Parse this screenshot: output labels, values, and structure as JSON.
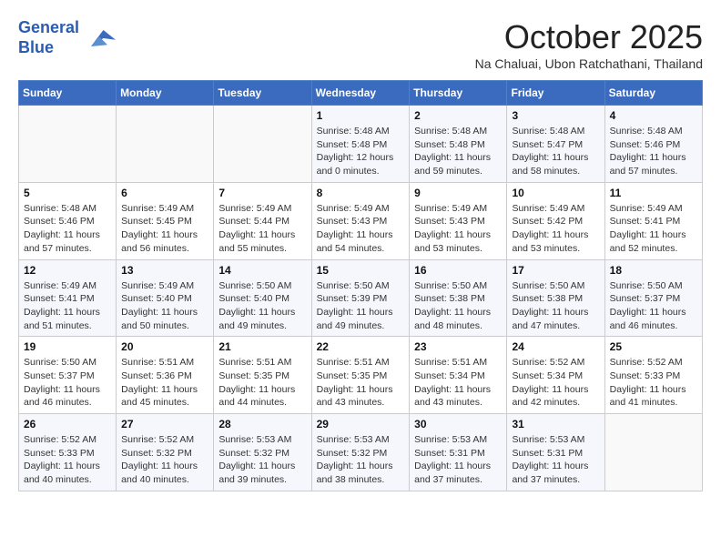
{
  "header": {
    "logo_line1": "General",
    "logo_line2": "Blue",
    "month": "October 2025",
    "location": "Na Chaluai, Ubon Ratchathani, Thailand"
  },
  "days_of_week": [
    "Sunday",
    "Monday",
    "Tuesday",
    "Wednesday",
    "Thursday",
    "Friday",
    "Saturday"
  ],
  "weeks": [
    [
      {
        "day": "",
        "info": ""
      },
      {
        "day": "",
        "info": ""
      },
      {
        "day": "",
        "info": ""
      },
      {
        "day": "1",
        "info": "Sunrise: 5:48 AM\nSunset: 5:48 PM\nDaylight: 12 hours\nand 0 minutes."
      },
      {
        "day": "2",
        "info": "Sunrise: 5:48 AM\nSunset: 5:48 PM\nDaylight: 11 hours\nand 59 minutes."
      },
      {
        "day": "3",
        "info": "Sunrise: 5:48 AM\nSunset: 5:47 PM\nDaylight: 11 hours\nand 58 minutes."
      },
      {
        "day": "4",
        "info": "Sunrise: 5:48 AM\nSunset: 5:46 PM\nDaylight: 11 hours\nand 57 minutes."
      }
    ],
    [
      {
        "day": "5",
        "info": "Sunrise: 5:48 AM\nSunset: 5:46 PM\nDaylight: 11 hours\nand 57 minutes."
      },
      {
        "day": "6",
        "info": "Sunrise: 5:49 AM\nSunset: 5:45 PM\nDaylight: 11 hours\nand 56 minutes."
      },
      {
        "day": "7",
        "info": "Sunrise: 5:49 AM\nSunset: 5:44 PM\nDaylight: 11 hours\nand 55 minutes."
      },
      {
        "day": "8",
        "info": "Sunrise: 5:49 AM\nSunset: 5:43 PM\nDaylight: 11 hours\nand 54 minutes."
      },
      {
        "day": "9",
        "info": "Sunrise: 5:49 AM\nSunset: 5:43 PM\nDaylight: 11 hours\nand 53 minutes."
      },
      {
        "day": "10",
        "info": "Sunrise: 5:49 AM\nSunset: 5:42 PM\nDaylight: 11 hours\nand 53 minutes."
      },
      {
        "day": "11",
        "info": "Sunrise: 5:49 AM\nSunset: 5:41 PM\nDaylight: 11 hours\nand 52 minutes."
      }
    ],
    [
      {
        "day": "12",
        "info": "Sunrise: 5:49 AM\nSunset: 5:41 PM\nDaylight: 11 hours\nand 51 minutes."
      },
      {
        "day": "13",
        "info": "Sunrise: 5:49 AM\nSunset: 5:40 PM\nDaylight: 11 hours\nand 50 minutes."
      },
      {
        "day": "14",
        "info": "Sunrise: 5:50 AM\nSunset: 5:40 PM\nDaylight: 11 hours\nand 49 minutes."
      },
      {
        "day": "15",
        "info": "Sunrise: 5:50 AM\nSunset: 5:39 PM\nDaylight: 11 hours\nand 49 minutes."
      },
      {
        "day": "16",
        "info": "Sunrise: 5:50 AM\nSunset: 5:38 PM\nDaylight: 11 hours\nand 48 minutes."
      },
      {
        "day": "17",
        "info": "Sunrise: 5:50 AM\nSunset: 5:38 PM\nDaylight: 11 hours\nand 47 minutes."
      },
      {
        "day": "18",
        "info": "Sunrise: 5:50 AM\nSunset: 5:37 PM\nDaylight: 11 hours\nand 46 minutes."
      }
    ],
    [
      {
        "day": "19",
        "info": "Sunrise: 5:50 AM\nSunset: 5:37 PM\nDaylight: 11 hours\nand 46 minutes."
      },
      {
        "day": "20",
        "info": "Sunrise: 5:51 AM\nSunset: 5:36 PM\nDaylight: 11 hours\nand 45 minutes."
      },
      {
        "day": "21",
        "info": "Sunrise: 5:51 AM\nSunset: 5:35 PM\nDaylight: 11 hours\nand 44 minutes."
      },
      {
        "day": "22",
        "info": "Sunrise: 5:51 AM\nSunset: 5:35 PM\nDaylight: 11 hours\nand 43 minutes."
      },
      {
        "day": "23",
        "info": "Sunrise: 5:51 AM\nSunset: 5:34 PM\nDaylight: 11 hours\nand 43 minutes."
      },
      {
        "day": "24",
        "info": "Sunrise: 5:52 AM\nSunset: 5:34 PM\nDaylight: 11 hours\nand 42 minutes."
      },
      {
        "day": "25",
        "info": "Sunrise: 5:52 AM\nSunset: 5:33 PM\nDaylight: 11 hours\nand 41 minutes."
      }
    ],
    [
      {
        "day": "26",
        "info": "Sunrise: 5:52 AM\nSunset: 5:33 PM\nDaylight: 11 hours\nand 40 minutes."
      },
      {
        "day": "27",
        "info": "Sunrise: 5:52 AM\nSunset: 5:32 PM\nDaylight: 11 hours\nand 40 minutes."
      },
      {
        "day": "28",
        "info": "Sunrise: 5:53 AM\nSunset: 5:32 PM\nDaylight: 11 hours\nand 39 minutes."
      },
      {
        "day": "29",
        "info": "Sunrise: 5:53 AM\nSunset: 5:32 PM\nDaylight: 11 hours\nand 38 minutes."
      },
      {
        "day": "30",
        "info": "Sunrise: 5:53 AM\nSunset: 5:31 PM\nDaylight: 11 hours\nand 37 minutes."
      },
      {
        "day": "31",
        "info": "Sunrise: 5:53 AM\nSunset: 5:31 PM\nDaylight: 11 hours\nand 37 minutes."
      },
      {
        "day": "",
        "info": ""
      }
    ]
  ]
}
